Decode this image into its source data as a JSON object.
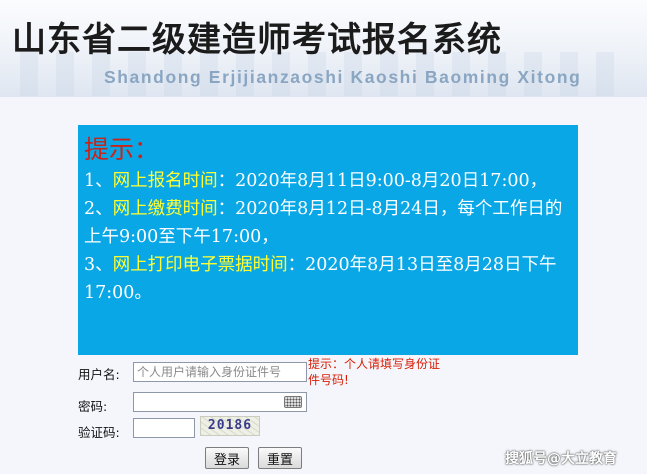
{
  "header": {
    "title_cn": "山东省二级建造师考试报名系统",
    "title_en": "Shandong Erjijianzaoshi Kaoshi Baoming Xitong"
  },
  "notice": {
    "heading": "提示：",
    "items": [
      {
        "prefix": "1、",
        "label": "网上报名时间",
        "text": "：2020年8月11日9:00-8月20日17:00，"
      },
      {
        "prefix": "2、",
        "label": "网上缴费时间",
        "text": "：2020年8月12日-8月24日，每个工作日的上午9:00至下午17:00，"
      },
      {
        "prefix": "3、",
        "label": "网上打印电子票据时间",
        "text": "：2020年8月13日至8月28日下午17:00。"
      }
    ]
  },
  "form": {
    "username_label": "用户名:",
    "username_placeholder": "个人用户请输入身份证件号",
    "username_hint": "提示：个人请填写身份证件号码!",
    "password_label": "密码:",
    "captcha_label": "验证码:",
    "captcha_value": "20186",
    "login_label": "登录",
    "reset_label": "重置"
  },
  "watermark": "搜狐号@大立教育",
  "icons": {
    "keyboard": "keyboard-icon"
  }
}
